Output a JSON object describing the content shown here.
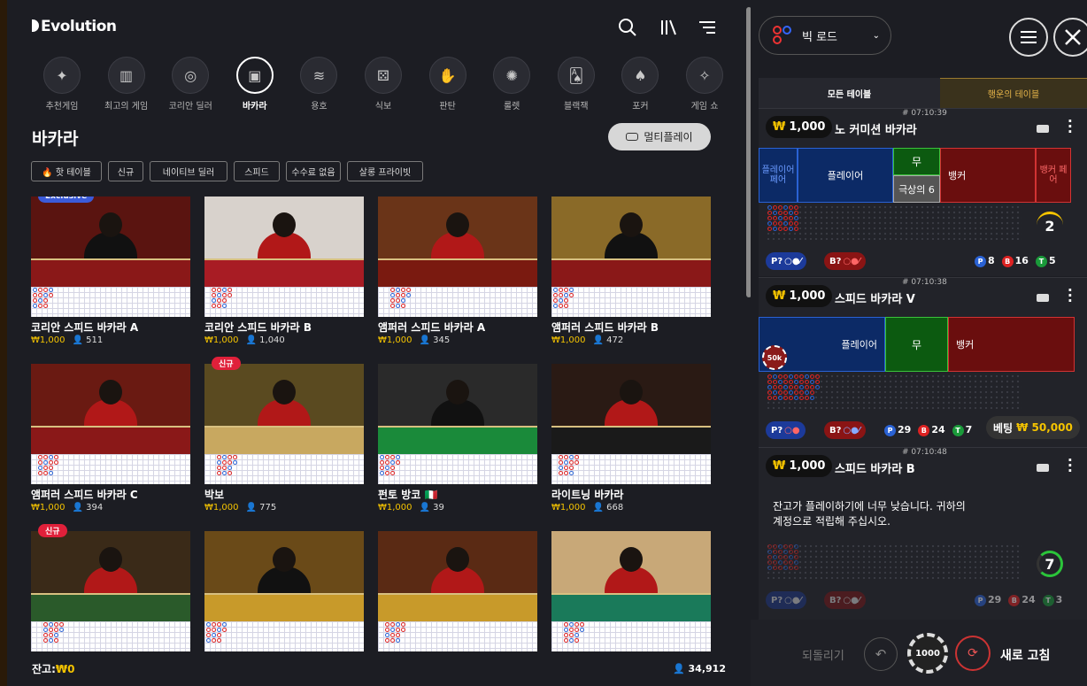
{
  "brand": "Evolution",
  "categories": [
    {
      "label": "추천게임",
      "icon": "sparkle-icon",
      "glyph": "✦"
    },
    {
      "label": "최고의 게임",
      "icon": "podium-icon",
      "glyph": "▥"
    },
    {
      "label": "코리안 딜러",
      "icon": "roulette-chip-icon",
      "glyph": "◎"
    },
    {
      "label": "바카라",
      "icon": "baccarat-table-icon",
      "glyph": "▣",
      "active": true
    },
    {
      "label": "용호",
      "icon": "dragon-icon",
      "glyph": "≋"
    },
    {
      "label": "식보",
      "icon": "dice-icon",
      "glyph": "⚄"
    },
    {
      "label": "판탄",
      "icon": "hand-icon",
      "glyph": "✋"
    },
    {
      "label": "룰렛",
      "icon": "roulette-icon",
      "glyph": "✺"
    },
    {
      "label": "블랙잭",
      "icon": "cards-icon",
      "glyph": "🂡"
    },
    {
      "label": "포커",
      "icon": "poker-icon",
      "glyph": "♠"
    },
    {
      "label": "게임 쇼",
      "icon": "mic-icon",
      "glyph": "✧"
    }
  ],
  "page_title": "바카라",
  "multiplay_label": "멀티플레이",
  "filters": [
    "🔥 핫 테이블",
    "신규",
    "네이티브 딜러",
    "스피드",
    "수수료 없음",
    "살롱 프라이빗"
  ],
  "tiles": [
    {
      "name": "코리안 스피드 바카라 A",
      "bet": "₩1,000",
      "players": "511",
      "badge": "Exclusive",
      "bg": "#5a1410",
      "felt": "#8a1818"
    },
    {
      "name": "코리안 스피드 바카라 B",
      "bet": "₩1,000",
      "players": "1,040",
      "badge": "",
      "bg": "#d8d2cc",
      "felt": "#a81c24"
    },
    {
      "name": "앰퍼러 스피드 바카라 A",
      "bet": "₩1,000",
      "players": "345",
      "badge": "",
      "bg": "#6a3418",
      "felt": "#7a1a10"
    },
    {
      "name": "앰퍼러 스피드 바카라 B",
      "bet": "₩1,000",
      "players": "472",
      "badge": "",
      "bg": "#8a6a28",
      "felt": "#8a1818"
    },
    {
      "name": "앰퍼러 스피드 바카라 C",
      "bet": "₩1,000",
      "players": "394",
      "badge": "",
      "bg": "#6a1a12",
      "felt": "#8a1818"
    },
    {
      "name": "박보",
      "bet": "₩1,000",
      "players": "775",
      "badge": "신규",
      "bg": "#5a4a20",
      "felt": "#c8a860"
    },
    {
      "name": "펀토 방코 🇮🇹",
      "bet": "₩1,000",
      "players": "39",
      "badge": "",
      "bg": "#2a2a2a",
      "felt": "#1a8a3a"
    },
    {
      "name": "라이트닝 바카라",
      "bet": "₩1,000",
      "players": "668",
      "badge": "",
      "bg": "#2a1a14",
      "felt": "#1a1a1a"
    },
    {
      "name": "",
      "bet": "",
      "players": "",
      "badge": "신규",
      "bg": "#3a2a18",
      "felt": "#2a5a2a"
    },
    {
      "name": "",
      "bet": "",
      "players": "",
      "badge": "",
      "bg": "#6a4a18",
      "felt": "#c89a2a"
    },
    {
      "name": "",
      "bet": "",
      "players": "",
      "badge": "",
      "bg": "#5a2a14",
      "felt": "#c89a2a"
    },
    {
      "name": "",
      "bet": "",
      "players": "",
      "badge": "",
      "bg": "#c8a878",
      "felt": "#1a7a5a"
    }
  ],
  "balance_label": "잔고:",
  "balance_value": "₩0",
  "total_players": "34,912",
  "right": {
    "road_label": "빅 로드",
    "tab_all": "모든 테이블",
    "tab_lucky": "행운의 테이블",
    "cards": [
      {
        "bet": "₩",
        "amount": "1,000",
        "name": "노 커미션 바카라",
        "time": "# 07:10:39",
        "player_pair": "플레이어 페어",
        "player": "플레이어",
        "tie": "무",
        "extra": "극상의 6",
        "banker": "뱅커",
        "banker_pair": "뱅커 페어",
        "p_label": "P?",
        "b_label": "B?",
        "p": "8",
        "b": "16",
        "t": "5",
        "count": "2"
      },
      {
        "bet": "₩",
        "amount": "1,000",
        "name": "스피드 바카라 V",
        "time": "# 07:10:38",
        "player": "플레이어",
        "tie": "무",
        "banker": "뱅커",
        "chip": "50k",
        "p_label": "P?",
        "b_label": "B?",
        "p": "29",
        "b": "24",
        "t": "7",
        "betting_label": "베팅",
        "betting_value": "₩ 50,000"
      },
      {
        "bet": "₩",
        "amount": "1,000",
        "name": "스피드 바카라 B",
        "time": "# 07:10:48",
        "message1": "잔고가 플레이하기에 너무 낮습니다. 귀하의",
        "message2": "계정으로 적립해 주십시오.",
        "p_label": "P?",
        "b_label": "B?",
        "p": "29",
        "b": "24",
        "t": "3",
        "count": "7"
      }
    ],
    "undo_label": "되돌리기",
    "chip_value": "1000",
    "refresh_label": "새로 고침"
  }
}
